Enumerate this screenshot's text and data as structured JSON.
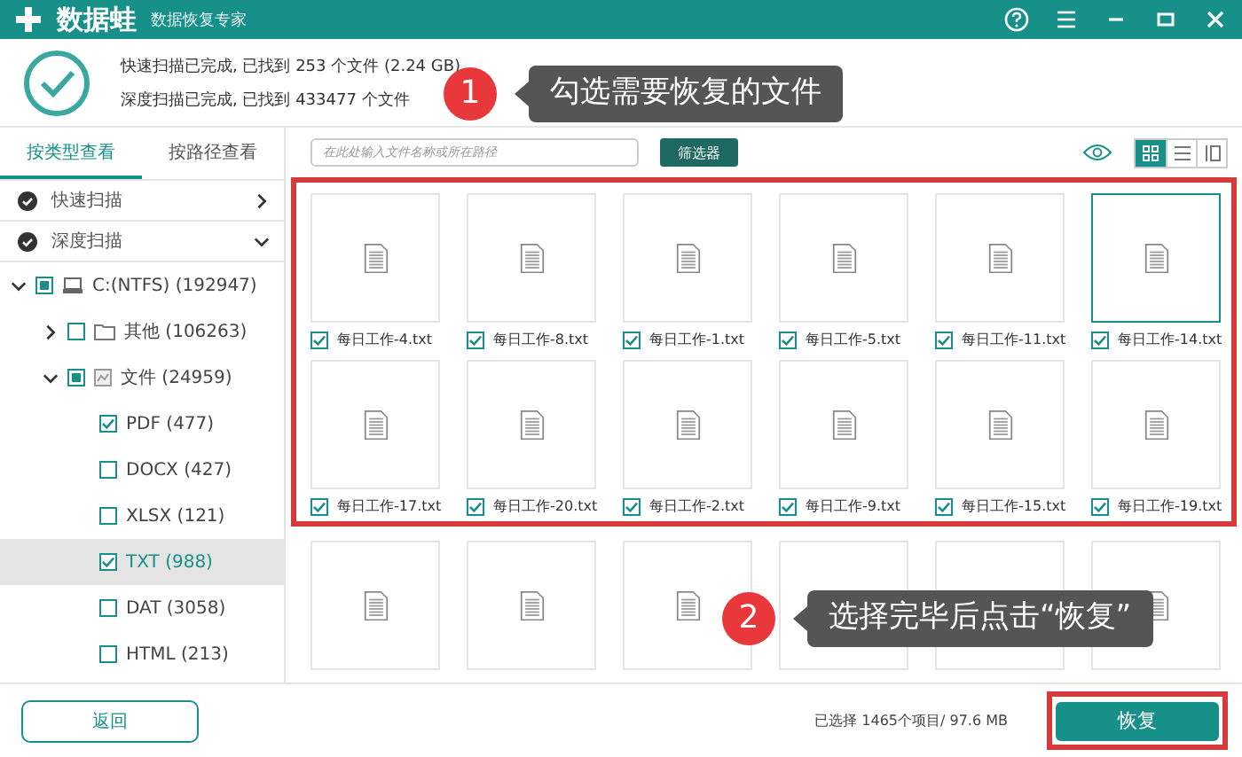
{
  "app": {
    "name": "数据蛙",
    "subtitle": "数据恢复专家"
  },
  "scan_summary": [
    "快速扫描已完成, 已找到 253 个文件 (2.24 GB)",
    "深度扫描已完成, 已找到 433477 个文件"
  ],
  "sidebar": {
    "tabs": [
      {
        "label": "按类型查看",
        "selected": true
      },
      {
        "label": "按路径查看",
        "selected": false
      }
    ],
    "sections": [
      {
        "label": "快速扫描",
        "expanded": false
      },
      {
        "label": "深度扫描",
        "expanded": true
      }
    ],
    "tree": [
      {
        "label": "C:(NTFS) (192947)",
        "partial": true,
        "expanded": true,
        "selected": false,
        "children": [
          {
            "label": "其他 (106263)",
            "checked": false,
            "partial": false,
            "expanded": false,
            "selected": false
          },
          {
            "label": "文件 (24959)",
            "partial": true,
            "expanded": true,
            "selected": false,
            "children": [
              {
                "label": "PDF (477)",
                "checked": true,
                "partial": false,
                "selected": false
              },
              {
                "label": "DOCX (427)",
                "checked": false,
                "partial": false,
                "selected": false
              },
              {
                "label": "XLSX (121)",
                "checked": false,
                "partial": false,
                "selected": false
              },
              {
                "label": "TXT (988)",
                "checked": true,
                "partial": false,
                "selected": true
              },
              {
                "label": "DAT (3058)",
                "checked": false,
                "partial": false,
                "selected": false
              },
              {
                "label": "HTML (213)",
                "checked": false,
                "partial": false,
                "selected": false
              }
            ]
          }
        ]
      }
    ]
  },
  "toolbar": {
    "search_placeholder": "在此处输入文件名称或所在路径",
    "filter_button": "筛选器",
    "views": [
      {
        "kind": "grid",
        "selected": true
      },
      {
        "kind": "list",
        "selected": false
      },
      {
        "kind": "detail",
        "selected": false
      }
    ]
  },
  "files": [
    {
      "name": "每日工作-4.txt",
      "checked": true,
      "selected": false
    },
    {
      "name": "每日工作-8.txt",
      "checked": true,
      "selected": false
    },
    {
      "name": "每日工作-1.txt",
      "checked": true,
      "selected": false
    },
    {
      "name": "每日工作-5.txt",
      "checked": true,
      "selected": false
    },
    {
      "name": "每日工作-11.txt",
      "checked": true,
      "selected": false
    },
    {
      "name": "每日工作-14.txt",
      "checked": true,
      "selected": true
    },
    {
      "name": "每日工作-17.txt",
      "checked": true,
      "selected": false
    },
    {
      "name": "每日工作-20.txt",
      "checked": true,
      "selected": false
    },
    {
      "name": "每日工作-2.txt",
      "checked": true,
      "selected": false
    },
    {
      "name": "每日工作-9.txt",
      "checked": true,
      "selected": false
    },
    {
      "name": "每日工作-15.txt",
      "checked": true,
      "selected": false
    },
    {
      "name": "每日工作-19.txt",
      "checked": true,
      "selected": false
    }
  ],
  "callouts": [
    {
      "number": "1",
      "text": "勾选需要恢复的文件"
    },
    {
      "number": "2",
      "text": "选择完毕后点击“恢复”"
    }
  ],
  "footer": {
    "back_button": "返回",
    "status": "已选择 1465个项目/ 97.6 MB",
    "recover_button": "恢复"
  }
}
